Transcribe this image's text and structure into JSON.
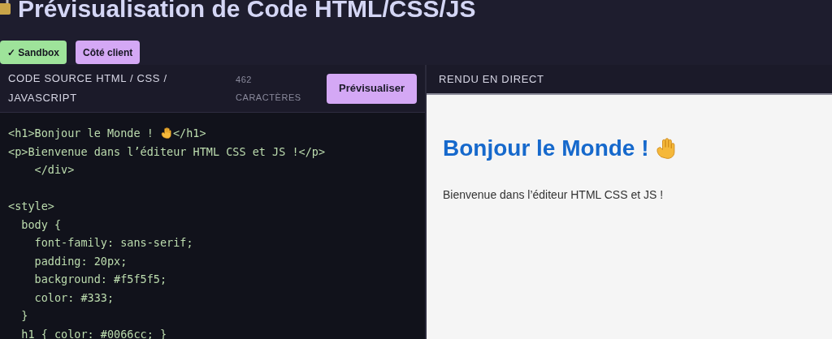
{
  "title": "Prévisualisation de Code HTML/CSS/JS",
  "badges": [
    {
      "label": "✓ Sandbox",
      "color": "#9ee39a"
    },
    {
      "label": "Côté client",
      "color": "#d4a8f5"
    }
  ],
  "editor": {
    "title": "CODE SOURCE HTML / CSS / JAVASCRIPT",
    "count": "462 CARACTÈRES",
    "button": "Prévisualiser",
    "lines": [
      {
        "text": "<h1>Bonjour le Monde ! ",
        "wave": true,
        "after": "</h1>"
      },
      {
        "text": "<p>Bienvenue dans l’éditeur HTML CSS et JS !</p>"
      },
      {
        "text": "    </div>"
      },
      {
        "text": "<style>",
        "gap_before": true
      },
      {
        "text": "  body {"
      },
      {
        "text": "    font-family: sans-serif;"
      },
      {
        "text": "    padding: 20px;"
      },
      {
        "text": "    background: #f5f5f5;"
      },
      {
        "text": "    color: #333;"
      },
      {
        "text": "  }"
      },
      {
        "text": "  h1 { color: #0066cc; }"
      }
    ]
  },
  "preview": {
    "title": "RENDU EN DIRECT",
    "heading": "Bonjour le Monde !",
    "heading_wave": true,
    "paragraph": "Bienvenue dans l’éditeur HTML CSS et JS !"
  }
}
